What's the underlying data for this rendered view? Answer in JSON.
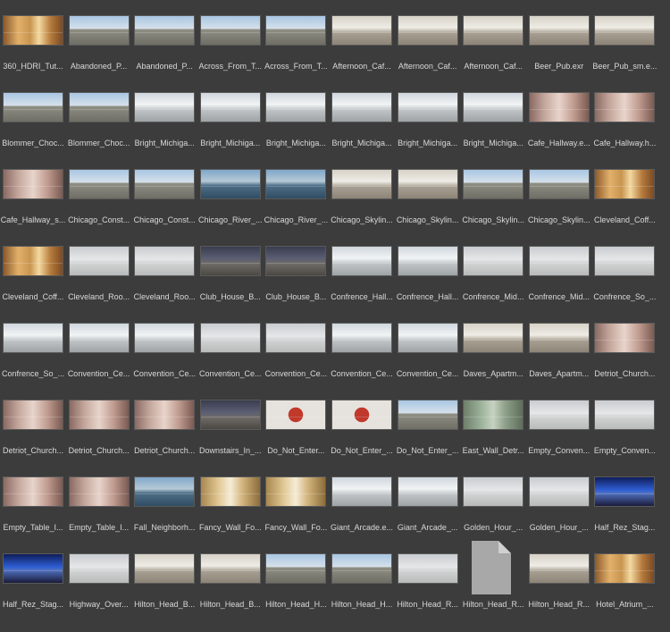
{
  "tiles": [
    {
      "label": "360_HDRI_Tut...",
      "tone": "warm"
    },
    {
      "label": "Abandoned_P...",
      "tone": "sky"
    },
    {
      "label": "Abandoned_P...",
      "tone": "sky"
    },
    {
      "label": "Across_From_T...",
      "tone": "sky"
    },
    {
      "label": "Across_From_T...",
      "tone": "sky"
    },
    {
      "label": "Afternoon_Caf...",
      "tone": "hall"
    },
    {
      "label": "Afternoon_Caf...",
      "tone": "hall"
    },
    {
      "label": "Afternoon_Caf...",
      "tone": "hall"
    },
    {
      "label": "Beer_Pub.exr",
      "tone": "hall"
    },
    {
      "label": "Beer_Pub_sm.e...",
      "tone": "hall"
    },
    {
      "label": "Blommer_Choc...",
      "tone": "sky"
    },
    {
      "label": "Blommer_Choc...",
      "tone": "sky"
    },
    {
      "label": "Bright_Michiga...",
      "tone": "white"
    },
    {
      "label": "Bright_Michiga...",
      "tone": "white"
    },
    {
      "label": "Bright_Michiga...",
      "tone": "white"
    },
    {
      "label": "Bright_Michiga...",
      "tone": "white"
    },
    {
      "label": "Bright_Michiga...",
      "tone": "white"
    },
    {
      "label": "Bright_Michiga...",
      "tone": "white"
    },
    {
      "label": "Cafe_Hallway.e...",
      "tone": "red"
    },
    {
      "label": "Cafe_Hallway.h...",
      "tone": "red"
    },
    {
      "label": "Cafe_Hallway_s...",
      "tone": "red"
    },
    {
      "label": "Chicago_Const...",
      "tone": "sky"
    },
    {
      "label": "Chicago_Const...",
      "tone": "sky"
    },
    {
      "label": "Chicago_River_...",
      "tone": "lake"
    },
    {
      "label": "Chicago_River_...",
      "tone": "lake"
    },
    {
      "label": "Chicago_Skylin...",
      "tone": "hall"
    },
    {
      "label": "Chicago_Skylin...",
      "tone": "hall"
    },
    {
      "label": "Chicago_Skylin...",
      "tone": "sky"
    },
    {
      "label": "Chicago_Skylin...",
      "tone": "sky"
    },
    {
      "label": "Cleveland_Coff...",
      "tone": "warm"
    },
    {
      "label": "Cleveland_Coff...",
      "tone": "warm"
    },
    {
      "label": "Cleveland_Roo...",
      "tone": "fog"
    },
    {
      "label": "Cleveland_Roo...",
      "tone": "fog"
    },
    {
      "label": "Club_House_B...",
      "tone": "dark"
    },
    {
      "label": "Club_House_B...",
      "tone": "dark"
    },
    {
      "label": "Confrence_Hall...",
      "tone": "white"
    },
    {
      "label": "Confrence_Hall...",
      "tone": "white"
    },
    {
      "label": "Confrence_Mid...",
      "tone": "fog"
    },
    {
      "label": "Confrence_Mid...",
      "tone": "fog"
    },
    {
      "label": "Confrence_So_...",
      "tone": "fog"
    },
    {
      "label": "Confrence_So_...",
      "tone": "white"
    },
    {
      "label": "Convention_Ce...",
      "tone": "white"
    },
    {
      "label": "Convention_Ce...",
      "tone": "white"
    },
    {
      "label": "Convention_Ce...",
      "tone": "fog"
    },
    {
      "label": "Convention_Ce...",
      "tone": "fog"
    },
    {
      "label": "Convention_Ce...",
      "tone": "white"
    },
    {
      "label": "Convention_Ce...",
      "tone": "white"
    },
    {
      "label": "Daves_Apartm...",
      "tone": "hall"
    },
    {
      "label": "Daves_Apartm...",
      "tone": "hall"
    },
    {
      "label": "Detriot_Church...",
      "tone": "red"
    },
    {
      "label": "Detriot_Church...",
      "tone": "red"
    },
    {
      "label": "Detriot_Church...",
      "tone": "red"
    },
    {
      "label": "Detriot_Church...",
      "tone": "red"
    },
    {
      "label": "Downstairs_In_...",
      "tone": "dark"
    },
    {
      "label": "Do_Not_Enter...",
      "tone": "stop"
    },
    {
      "label": "Do_Not_Enter_...",
      "tone": "stop"
    },
    {
      "label": "Do_Not_Enter_...",
      "tone": "sky"
    },
    {
      "label": "East_Wall_Detr...",
      "tone": "green"
    },
    {
      "label": "Empty_Conven...",
      "tone": "fog"
    },
    {
      "label": "Empty_Conven...",
      "tone": "fog"
    },
    {
      "label": "Empty_Table_I...",
      "tone": "red"
    },
    {
      "label": "Empty_Table_I...",
      "tone": "red"
    },
    {
      "label": "Fall_Neighborh...",
      "tone": "lake"
    },
    {
      "label": "Fancy_Wall_Fo...",
      "tone": "gold"
    },
    {
      "label": "Fancy_Wall_Fo...",
      "tone": "gold"
    },
    {
      "label": "Giant_Arcade.e...",
      "tone": "white"
    },
    {
      "label": "Giant_Arcade_...",
      "tone": "white"
    },
    {
      "label": "Golden_Hour_...",
      "tone": "fog"
    },
    {
      "label": "Golden_Hour_...",
      "tone": "fog"
    },
    {
      "label": "Half_Rez_Stag...",
      "tone": "blue"
    },
    {
      "label": "Half_Rez_Stag...",
      "tone": "blue"
    },
    {
      "label": "Highway_Over...",
      "tone": "fog"
    },
    {
      "label": "Hilton_Head_B...",
      "tone": "hall"
    },
    {
      "label": "Hilton_Head_B...",
      "tone": "hall"
    },
    {
      "label": "Hilton_Head_H...",
      "tone": "sky"
    },
    {
      "label": "Hilton_Head_H...",
      "tone": "sky"
    },
    {
      "label": "Hilton_Head_R...",
      "tone": "fog"
    },
    {
      "label": "Hilton_Head_R...",
      "tone": "file"
    },
    {
      "label": "Hilton_Head_R...",
      "tone": "hall"
    },
    {
      "label": "Hotel_Atrium_...",
      "tone": "warm"
    }
  ]
}
